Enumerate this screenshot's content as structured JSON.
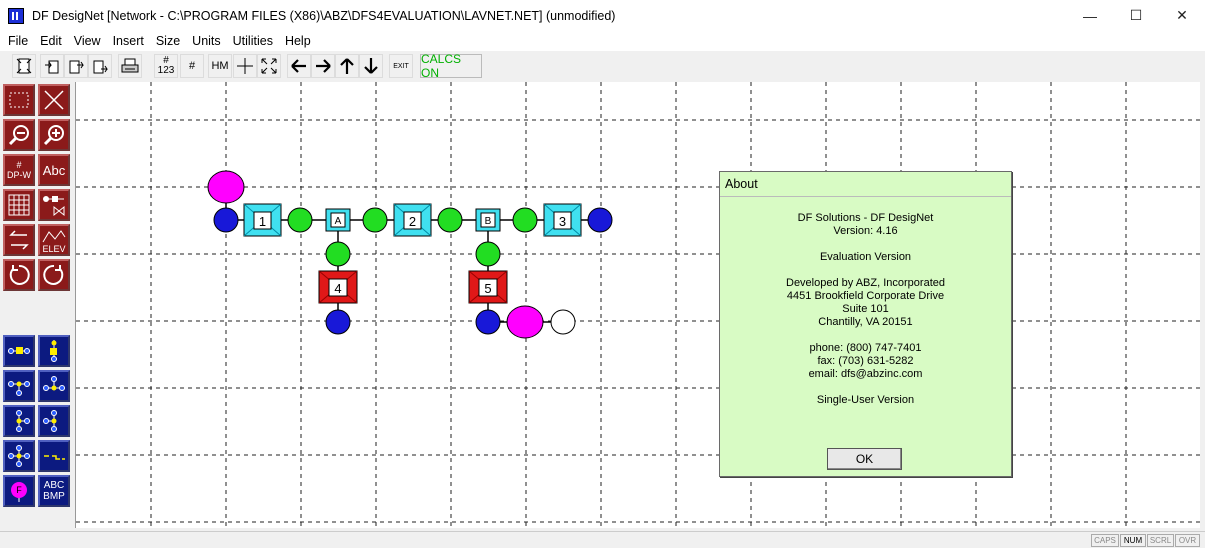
{
  "window": {
    "title": "DF DesigNet [Network - C:\\PROGRAM FILES (X86)\\ABZ\\DFS4EVALUATION\\LAVNET.NET] (unmodified)",
    "minimize": "—",
    "maximize": "☐",
    "close": "✕"
  },
  "menu": [
    "File",
    "Edit",
    "View",
    "Insert",
    "Size",
    "Units",
    "Utilities",
    "Help"
  ],
  "toolbar": {
    "numbers_top": "#",
    "numbers_bottom": "123",
    "hash": "#",
    "hm": "HM",
    "exit": "EXIT",
    "calcs": "CALCS ON"
  },
  "palette": {
    "dpw_top": "#",
    "dpw_bottom": "DP-W",
    "text": "Abc",
    "elev": "ELEV",
    "abc_bmp_top": "ABC",
    "abc_bmp_bottom": "BMP"
  },
  "network": {
    "node_labels": [
      "1",
      "A",
      "2",
      "B",
      "3",
      "4",
      "5"
    ]
  },
  "about": {
    "title": "About",
    "product": "DF Solutions - DF DesigNet",
    "version": "Version: 4.16",
    "edition": "Evaluation Version",
    "developer": "Developed by ABZ, Incorporated",
    "address1": "4451 Brookfield Corporate Drive",
    "address2": "Suite 101",
    "city": "Chantilly, VA  20151",
    "phone": "phone:  (800) 747-7401",
    "fax": "fax:  (703) 631-5282",
    "email": "email:  dfs@abzinc.com",
    "license": "Single-User Version",
    "ok": "OK"
  },
  "status": {
    "caps": "CAPS",
    "num": "NUM",
    "scrl": "SCRL",
    "ovr": "OVR"
  },
  "colors": {
    "palette_red": "#8b1a1a",
    "palette_blue": "#0c1a80",
    "dialog_bg": "#d8fbc4",
    "calcs_green": "#00b000",
    "node_blue": "#1818d8",
    "node_green": "#22dd22",
    "node_magenta": "#ff00ff",
    "node_cyan": "#40e0f0",
    "node_red": "#e01818"
  }
}
